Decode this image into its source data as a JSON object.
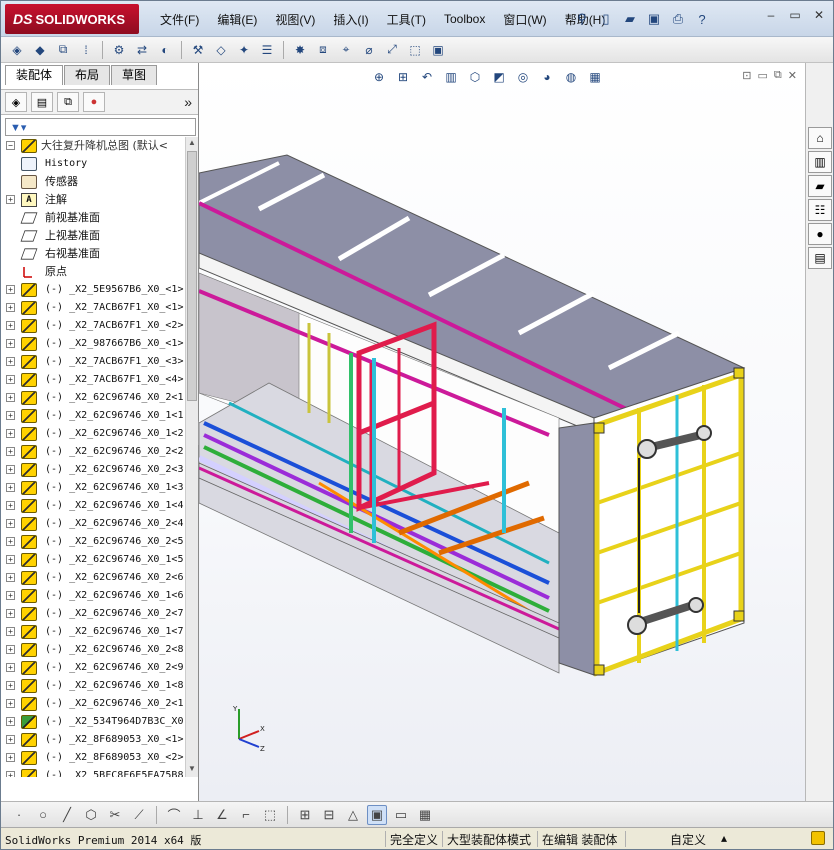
{
  "app": {
    "logo_text": "SOLIDWORKS",
    "logo_prefix": "DS"
  },
  "menu": [
    "文件(F)",
    "编辑(E)",
    "视图(V)",
    "插入(I)",
    "工具(T)",
    "Toolbox",
    "窗口(W)",
    "帮助(H)"
  ],
  "panel": {
    "tabs": [
      "装配体",
      "布局",
      "草图"
    ],
    "root": "大往复升降机总图 (默认<",
    "items": [
      {
        "type": "history",
        "label": "History"
      },
      {
        "type": "sensor",
        "label": "传感器"
      },
      {
        "type": "note",
        "label": "注解",
        "expand": true
      },
      {
        "type": "plane",
        "label": "前视基准面"
      },
      {
        "type": "plane",
        "label": "上视基准面"
      },
      {
        "type": "plane",
        "label": "右视基准面"
      },
      {
        "type": "origin",
        "label": "原点"
      },
      {
        "type": "part",
        "label": "(-) _X2_5E9567B6_X0_<1>"
      },
      {
        "type": "part",
        "label": "(-) _X2_7ACB67F1_X0_<1>"
      },
      {
        "type": "part",
        "label": "(-) _X2_7ACB67F1_X0_<2>"
      },
      {
        "type": "part",
        "label": "(-) _X2_987667B6_X0_<1>"
      },
      {
        "type": "part",
        "label": "(-) _X2_7ACB67F1_X0_<3>"
      },
      {
        "type": "part",
        "label": "(-) _X2_7ACB67F1_X0_<4>"
      },
      {
        "type": "part",
        "label": "(-) _X2_62C96746_X0_2<1"
      },
      {
        "type": "part",
        "label": "(-) _X2_62C96746_X0_1<1"
      },
      {
        "type": "part",
        "label": "(-) _X2_62C96746_X0_1<2"
      },
      {
        "type": "part",
        "label": "(-) _X2_62C96746_X0_2<2"
      },
      {
        "type": "part",
        "label": "(-) _X2_62C96746_X0_2<3"
      },
      {
        "type": "part",
        "label": "(-) _X2_62C96746_X0_1<3"
      },
      {
        "type": "part",
        "label": "(-) _X2_62C96746_X0_1<4"
      },
      {
        "type": "part",
        "label": "(-) _X2_62C96746_X0_2<4"
      },
      {
        "type": "part",
        "label": "(-) _X2_62C96746_X0_2<5"
      },
      {
        "type": "part",
        "label": "(-) _X2_62C96746_X0_1<5"
      },
      {
        "type": "part",
        "label": "(-) _X2_62C96746_X0_2<6"
      },
      {
        "type": "part",
        "label": "(-) _X2_62C96746_X0_1<6"
      },
      {
        "type": "part",
        "label": "(-) _X2_62C96746_X0_2<7"
      },
      {
        "type": "part",
        "label": "(-) _X2_62C96746_X0_1<7"
      },
      {
        "type": "part",
        "label": "(-) _X2_62C96746_X0_2<8"
      },
      {
        "type": "part",
        "label": "(-) _X2_62C96746_X0_2<9"
      },
      {
        "type": "part",
        "label": "(-) _X2_62C96746_X0_1<8"
      },
      {
        "type": "part",
        "label": "(-) _X2_62C96746_X0_2<1"
      },
      {
        "type": "part-green",
        "label": "(-) _X2_534T964D7B3C_X0"
      },
      {
        "type": "part",
        "label": "(-) _X2_8F689053_X0_<1>"
      },
      {
        "type": "part",
        "label": "(-) _X2_8F689053_X0_<2>"
      },
      {
        "type": "part",
        "label": "(-) _X2_5BFC8F6E5EA75B8"
      }
    ]
  },
  "status": {
    "app": "SolidWorks Premium 2014 x64 版",
    "full_defined": "完全定义",
    "large_mode": "大型装配体模式",
    "editing": "在编辑 装配体",
    "custom": "自定义"
  }
}
